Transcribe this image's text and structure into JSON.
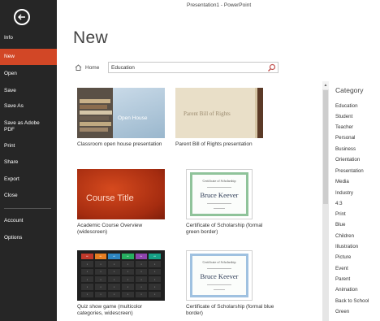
{
  "window": {
    "title": "Presentation1 - PowerPoint"
  },
  "sidebar": {
    "back_icon": "back-arrow-icon",
    "items": [
      {
        "label": "Info"
      },
      {
        "label": "New",
        "selected": true
      },
      {
        "label": "Open"
      },
      {
        "label": "Save"
      },
      {
        "label": "Save As"
      },
      {
        "label": "Save as Adobe PDF"
      },
      {
        "label": "Print"
      },
      {
        "label": "Share"
      },
      {
        "label": "Export"
      },
      {
        "label": "Close"
      },
      {
        "label": "Account"
      },
      {
        "label": "Options"
      }
    ],
    "accent_color": "#d24726"
  },
  "main": {
    "title": "New",
    "home_label": "Home",
    "search": {
      "value": "Education",
      "placeholder": ""
    },
    "templates": [
      {
        "caption": "Classroom open house presentation",
        "thumb_text": "Open House"
      },
      {
        "caption": "Parent Bill of Rights presentation",
        "thumb_text": "Parent Bill of Rights"
      },
      {
        "caption": "Academic Course Overview (widescreen)",
        "thumb_text": "Course Title"
      },
      {
        "caption": "Certificate of Scholarship (formal green border)",
        "thumb_heading": "Certificate of Scholarship",
        "thumb_name": "Bruce Keever"
      },
      {
        "caption": "Quiz show game (multicolor categories, widescreen)"
      },
      {
        "caption": "Certificate of Scholarship (formal blue border)",
        "thumb_heading": "Certificate of Scholarship",
        "thumb_name": "Bruce Keever"
      }
    ]
  },
  "category_panel": {
    "title": "Category",
    "items": [
      "Education",
      "Student",
      "Teacher",
      "Personal",
      "Business",
      "Orientation",
      "Presentation",
      "Media",
      "Industry",
      "4:3",
      "Print",
      "Blue",
      "Children",
      "Illustration",
      "Picture",
      "Event",
      "Parent",
      "Animation",
      "Back to School",
      "Green"
    ]
  }
}
